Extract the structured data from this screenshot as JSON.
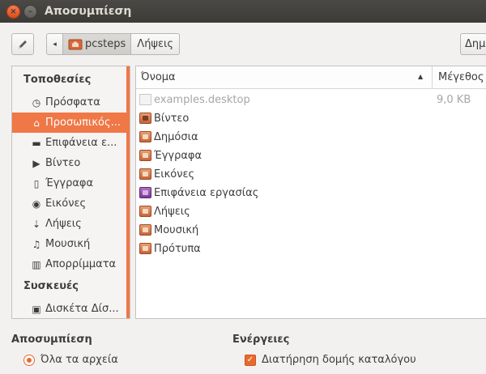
{
  "window": {
    "title": "Αποσυμπίεση",
    "close_glyph": "×",
    "minimize_glyph": "–"
  },
  "toolbar": {
    "edit_icon": "pencil-icon",
    "back_glyph": "◂",
    "path": [
      "pcsteps",
      "Λήψεις"
    ],
    "right_button_label": "Δημ"
  },
  "sidebar": {
    "places_heading": "Τοποθεσίες",
    "places": [
      {
        "label": "Πρόσφατα",
        "icon": "clock-icon",
        "glyph": "◷",
        "selected": false
      },
      {
        "label": "Προσωπικός...",
        "icon": "home-icon",
        "glyph": "⌂",
        "selected": true
      },
      {
        "label": "Επιφάνεια ε...",
        "icon": "desktop-icon",
        "glyph": "▬",
        "selected": false
      },
      {
        "label": "Βίντεο",
        "icon": "video-icon",
        "glyph": "▶",
        "selected": false
      },
      {
        "label": "Έγγραφα",
        "icon": "document-icon",
        "glyph": "▯",
        "selected": false
      },
      {
        "label": "Εικόνες",
        "icon": "camera-icon",
        "glyph": "◉",
        "selected": false
      },
      {
        "label": "Λήψεις",
        "icon": "download-icon",
        "glyph": "⇣",
        "selected": false
      },
      {
        "label": "Μουσική",
        "icon": "music-icon",
        "glyph": "♫",
        "selected": false
      },
      {
        "label": "Απορρίμματα",
        "icon": "trash-icon",
        "glyph": "▥",
        "selected": false
      }
    ],
    "devices_heading": "Συσκευές",
    "devices": [
      {
        "label": "Δισκέτα Δίσ...",
        "icon": "floppy-icon",
        "glyph": "▣"
      }
    ],
    "accent_color": "#f07746"
  },
  "filelist": {
    "columns": {
      "name": "Όνομα",
      "size": "Μέγεθος",
      "sort_glyph": "▲"
    },
    "rows": [
      {
        "name": "examples.desktop",
        "size": "9,0 KB",
        "type": "file",
        "dim": true
      },
      {
        "name": "Βίντεο",
        "size": "",
        "type": "folder-video",
        "dim": false
      },
      {
        "name": "Δημόσια",
        "size": "",
        "type": "folder",
        "dim": false
      },
      {
        "name": "Έγγραφα",
        "size": "",
        "type": "folder",
        "dim": false
      },
      {
        "name": "Εικόνες",
        "size": "",
        "type": "folder",
        "dim": false
      },
      {
        "name": "Επιφάνεια εργασίας",
        "size": "",
        "type": "folder-desktop",
        "dim": false
      },
      {
        "name": "Λήψεις",
        "size": "",
        "type": "folder",
        "dim": false
      },
      {
        "name": "Μουσική",
        "size": "",
        "type": "folder",
        "dim": false
      },
      {
        "name": "Πρότυπα",
        "size": "",
        "type": "folder",
        "dim": false
      }
    ]
  },
  "extract": {
    "heading": "Αποσυμπίεση",
    "all_files_label": "Όλα τα αρχεία",
    "all_files_selected": true
  },
  "actions": {
    "heading": "Ενέργειες",
    "keep_structure_label": "Διατήρηση δομής καταλόγου",
    "keep_structure_checked": true,
    "check_glyph": "✓"
  }
}
